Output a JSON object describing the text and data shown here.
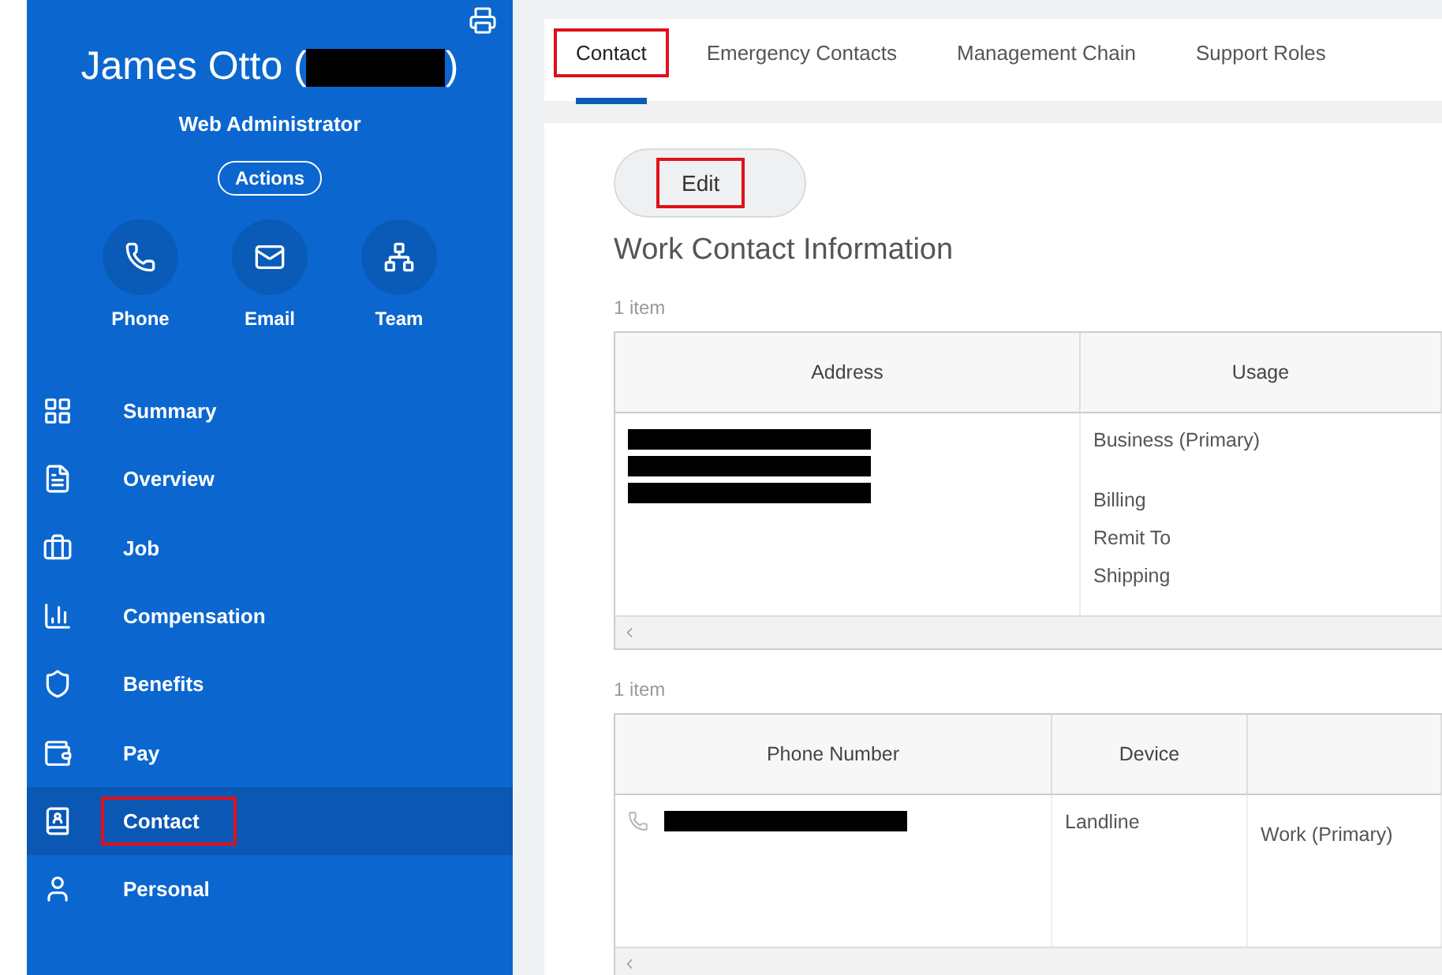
{
  "profile": {
    "name_prefix": "James Otto (",
    "name_suffix": ")",
    "job_title": "Web Administrator",
    "actions_button": "Actions",
    "quick_actions": [
      {
        "kind": "phone",
        "label": "Phone"
      },
      {
        "kind": "email",
        "label": "Email"
      },
      {
        "kind": "team",
        "label": "Team"
      }
    ]
  },
  "sidebar": {
    "items": [
      {
        "kind": "summary",
        "label": "Summary",
        "selected": false,
        "highlighted": false
      },
      {
        "kind": "overview",
        "label": "Overview",
        "selected": false,
        "highlighted": false
      },
      {
        "kind": "job",
        "label": "Job",
        "selected": false,
        "highlighted": false
      },
      {
        "kind": "compensation",
        "label": "Compensation",
        "selected": false,
        "highlighted": false
      },
      {
        "kind": "benefits",
        "label": "Benefits",
        "selected": false,
        "highlighted": false
      },
      {
        "kind": "pay",
        "label": "Pay",
        "selected": false,
        "highlighted": false
      },
      {
        "kind": "contact",
        "label": "Contact",
        "selected": true,
        "highlighted": true
      },
      {
        "kind": "personal",
        "label": "Personal",
        "selected": false,
        "highlighted": false
      }
    ]
  },
  "tabs": [
    {
      "label": "Contact",
      "selected": true,
      "highlighted": true
    },
    {
      "label": "Emergency Contacts",
      "selected": false,
      "highlighted": false
    },
    {
      "label": "Management Chain",
      "selected": false,
      "highlighted": false
    },
    {
      "label": "Support Roles",
      "selected": false,
      "highlighted": false
    }
  ],
  "edit_button": {
    "label": "Edit",
    "highlighted": true
  },
  "section_title": "Work Contact Information",
  "address_table": {
    "count": "1 item",
    "columns": [
      "Address",
      "Usage"
    ],
    "usage": [
      "Business (Primary)",
      "Billing",
      "Remit To",
      "Shipping"
    ]
  },
  "phone_table": {
    "count": "1 item",
    "columns": [
      "Phone Number",
      "Device"
    ],
    "device": "Landline",
    "column_3": "Work (Primary)"
  }
}
